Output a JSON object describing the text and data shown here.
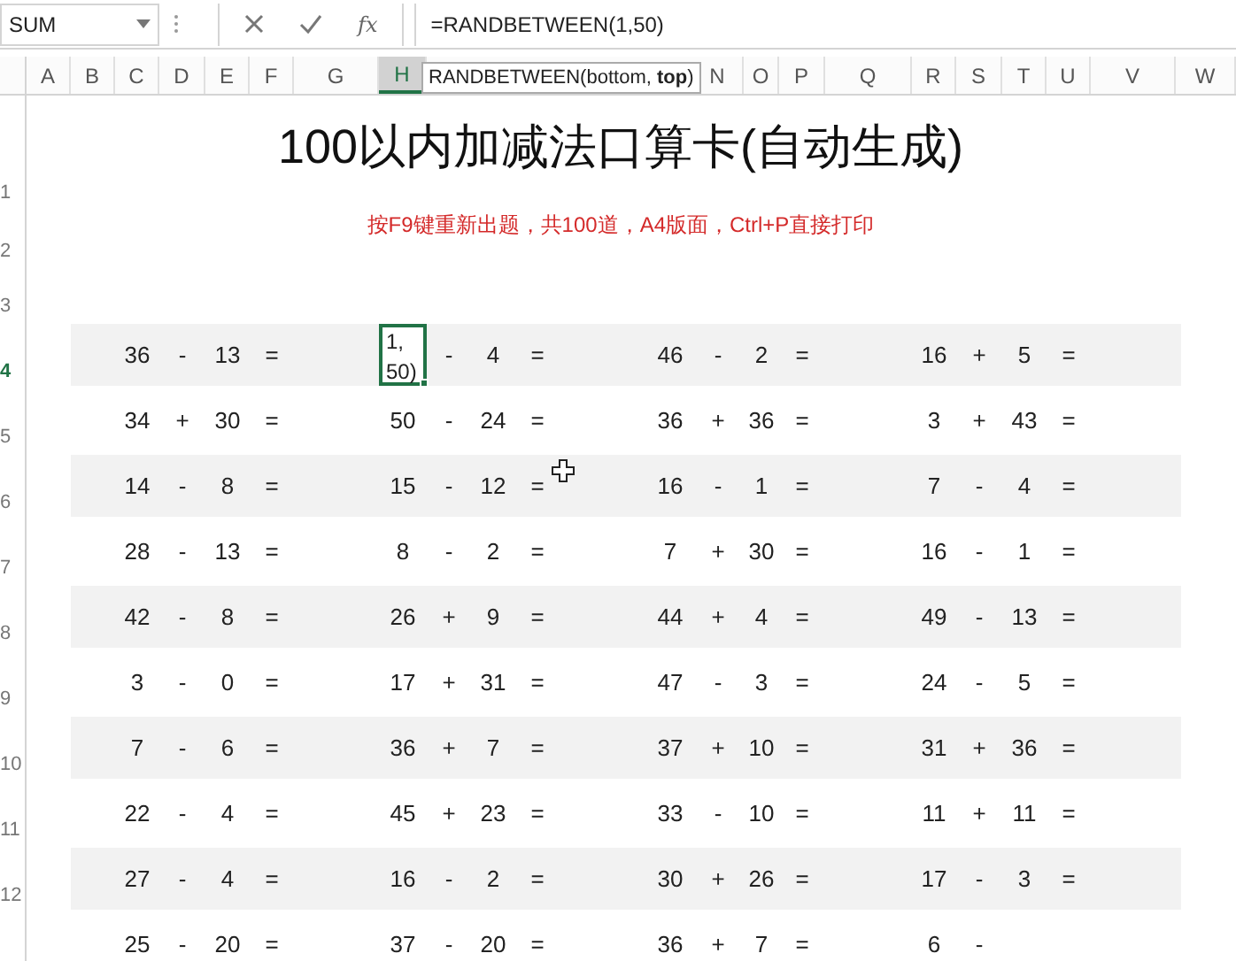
{
  "formula_bar": {
    "name_box": "SUM",
    "function_button": "fx",
    "formula": "=RANDBETWEEN(1,50)"
  },
  "tooltip": "RANDBETWEEN(bottom, **top**)",
  "column_headers": [
    {
      "label": "A",
      "selected": false
    },
    {
      "label": "B",
      "selected": false
    },
    {
      "label": "C",
      "selected": false
    },
    {
      "label": "D",
      "selected": false
    },
    {
      "label": "E",
      "selected": false
    },
    {
      "label": "F",
      "selected": false
    },
    {
      "label": "G",
      "selected": false
    },
    {
      "label": "H",
      "selected": true
    },
    {
      "label": "N",
      "selected": false
    },
    {
      "label": "O",
      "selected": false
    },
    {
      "label": "P",
      "selected": false
    },
    {
      "label": "Q",
      "selected": false
    },
    {
      "label": "R",
      "selected": false
    },
    {
      "label": "S",
      "selected": false
    },
    {
      "label": "T",
      "selected": false
    },
    {
      "label": "U",
      "selected": false
    },
    {
      "label": "V",
      "selected": false
    },
    {
      "label": "W",
      "selected": false
    }
  ],
  "row_headers": [
    {
      "label": "1",
      "selected": false
    },
    {
      "label": "2",
      "selected": false
    },
    {
      "label": "3",
      "selected": false
    },
    {
      "label": "4",
      "selected": true
    },
    {
      "label": "5",
      "selected": false
    },
    {
      "label": "6",
      "selected": false
    },
    {
      "label": "7",
      "selected": false
    },
    {
      "label": "8",
      "selected": false
    },
    {
      "label": "9",
      "selected": false
    },
    {
      "label": "10",
      "selected": false
    },
    {
      "label": "11",
      "selected": false
    },
    {
      "label": "12",
      "selected": false
    }
  ],
  "title": "100以内加减法口算卡(自动生成)",
  "subtitle": "按F9键重新出题，共100道，A4版面，Ctrl+P直接打印",
  "rows": [
    {
      "problems": [
        {
          "a": "36",
          "op": "-",
          "b": "13",
          "eq": "=",
          "selected": false
        },
        {
          "a": "1, 50)",
          "op": "-",
          "b": "4",
          "eq": "=",
          "selected": true
        },
        {
          "a": "46",
          "op": "-",
          "b": "2",
          "eq": "=",
          "selected": false
        },
        {
          "a": "16",
          "op": "+",
          "b": "5",
          "eq": "=",
          "selected": false
        }
      ]
    },
    {
      "problems": [
        {
          "a": "34",
          "op": "+",
          "b": "30",
          "eq": "=",
          "selected": false
        },
        {
          "a": "50",
          "op": "-",
          "b": "24",
          "eq": "=",
          "selected": false
        },
        {
          "a": "36",
          "op": "+",
          "b": "36",
          "eq": "=",
          "selected": false
        },
        {
          "a": "3",
          "op": "+",
          "b": "43",
          "eq": "=",
          "selected": false
        }
      ]
    },
    {
      "problems": [
        {
          "a": "14",
          "op": "-",
          "b": "8",
          "eq": "=",
          "selected": false
        },
        {
          "a": "15",
          "op": "-",
          "b": "12",
          "eq": "=",
          "selected": false
        },
        {
          "a": "16",
          "op": "-",
          "b": "1",
          "eq": "=",
          "selected": false
        },
        {
          "a": "7",
          "op": "-",
          "b": "4",
          "eq": "=",
          "selected": false
        }
      ]
    },
    {
      "problems": [
        {
          "a": "28",
          "op": "-",
          "b": "13",
          "eq": "=",
          "selected": false
        },
        {
          "a": "8",
          "op": "-",
          "b": "2",
          "eq": "=",
          "selected": false
        },
        {
          "a": "7",
          "op": "+",
          "b": "30",
          "eq": "=",
          "selected": false
        },
        {
          "a": "16",
          "op": "-",
          "b": "1",
          "eq": "=",
          "selected": false
        }
      ]
    },
    {
      "problems": [
        {
          "a": "42",
          "op": "-",
          "b": "8",
          "eq": "=",
          "selected": false
        },
        {
          "a": "26",
          "op": "+",
          "b": "9",
          "eq": "=",
          "selected": false
        },
        {
          "a": "44",
          "op": "+",
          "b": "4",
          "eq": "=",
          "selected": false
        },
        {
          "a": "49",
          "op": "-",
          "b": "13",
          "eq": "=",
          "selected": false
        }
      ]
    },
    {
      "problems": [
        {
          "a": "3",
          "op": "-",
          "b": "0",
          "eq": "=",
          "selected": false
        },
        {
          "a": "17",
          "op": "+",
          "b": "31",
          "eq": "=",
          "selected": false
        },
        {
          "a": "47",
          "op": "-",
          "b": "3",
          "eq": "=",
          "selected": false
        },
        {
          "a": "24",
          "op": "-",
          "b": "5",
          "eq": "=",
          "selected": false
        }
      ]
    },
    {
      "problems": [
        {
          "a": "7",
          "op": "-",
          "b": "6",
          "eq": "=",
          "selected": false
        },
        {
          "a": "36",
          "op": "+",
          "b": "7",
          "eq": "=",
          "selected": false
        },
        {
          "a": "37",
          "op": "+",
          "b": "10",
          "eq": "=",
          "selected": false
        },
        {
          "a": "31",
          "op": "+",
          "b": "36",
          "eq": "=",
          "selected": false
        }
      ]
    },
    {
      "problems": [
        {
          "a": "22",
          "op": "-",
          "b": "4",
          "eq": "=",
          "selected": false
        },
        {
          "a": "45",
          "op": "+",
          "b": "23",
          "eq": "=",
          "selected": false
        },
        {
          "a": "33",
          "op": "-",
          "b": "10",
          "eq": "=",
          "selected": false
        },
        {
          "a": "11",
          "op": "+",
          "b": "11",
          "eq": "=",
          "selected": false
        }
      ]
    },
    {
      "problems": [
        {
          "a": "27",
          "op": "-",
          "b": "4",
          "eq": "=",
          "selected": false
        },
        {
          "a": "16",
          "op": "-",
          "b": "2",
          "eq": "=",
          "selected": false
        },
        {
          "a": "30",
          "op": "+",
          "b": "26",
          "eq": "=",
          "selected": false
        },
        {
          "a": "17",
          "op": "-",
          "b": "3",
          "eq": "=",
          "selected": false
        }
      ]
    },
    {
      "problems": [
        {
          "a": "25",
          "op": "-",
          "b": "20",
          "eq": "=",
          "selected": false
        },
        {
          "a": "37",
          "op": "-",
          "b": "20",
          "eq": "=",
          "selected": false
        },
        {
          "a": "36",
          "op": "+",
          "b": "7",
          "eq": "=",
          "selected": false
        },
        {
          "a": "6",
          "op": "-",
          "selected": false
        }
      ]
    }
  ]
}
